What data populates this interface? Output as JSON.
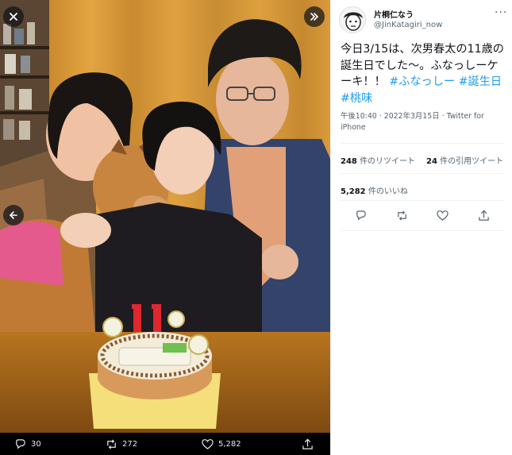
{
  "viewer": {
    "photo_alt": "",
    "counts": {
      "replies": "30",
      "retweets": "272",
      "likes": "5,282"
    }
  },
  "tweet": {
    "author": {
      "name": "片桐仁なう",
      "handle": "@JinKatagiri_now"
    },
    "more_label": "···",
    "text_main": "今日3/15は、次男春太の11歳の誕生日でした〜。ふなっしーケーキ！！",
    "hashtags": [
      "#ふなっしー",
      "#誕生日",
      "#桃味"
    ],
    "meta": {
      "time": "午後10:40",
      "date": "2022年3月15日",
      "source": "Twitter for iPhone"
    },
    "stats": {
      "retweets_num": "248",
      "retweets_label": "件のリツイート",
      "quotes_num": "24",
      "quotes_label": "件の引用ツイート",
      "likes_num": "5,282",
      "likes_label": "件のいいね"
    }
  },
  "icons": {
    "close": "close-icon",
    "expand": "chevron-double-right-icon",
    "prev": "arrow-left-icon",
    "reply": "reply-icon",
    "retweet": "retweet-icon",
    "like": "heart-icon",
    "share": "share-icon",
    "more": "more-icon"
  },
  "colors": {
    "accent": "#1d9bf0",
    "text": "#0f1419",
    "muted": "#536471",
    "viewer_bg": "#000000"
  }
}
